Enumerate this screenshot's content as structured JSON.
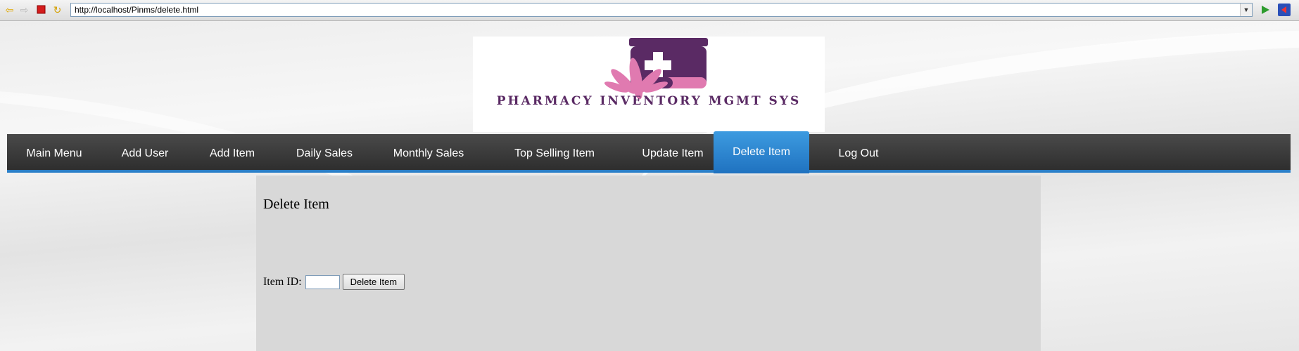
{
  "browser": {
    "url": "http://localhost/Pinms/delete.html",
    "back_icon": "back-arrow-icon",
    "forward_icon": "forward-arrow-icon",
    "stop_icon": "stop-icon",
    "refresh_icon": "refresh-icon",
    "go_icon": "go-arrow-icon",
    "exit_icon": "exit-icon"
  },
  "header": {
    "logo_title": "PHARMACY INVENTORY MGMT SYS",
    "colors": {
      "logo_purple": "#5a2a64",
      "logo_pink": "#e07ab0"
    }
  },
  "nav": {
    "items": [
      {
        "label": "Main Menu"
      },
      {
        "label": "Add User"
      },
      {
        "label": "Add Item"
      },
      {
        "label": "Daily Sales"
      },
      {
        "label": "Monthly Sales"
      },
      {
        "label": "Top Selling Item"
      },
      {
        "label": "Update Item"
      },
      {
        "label": "Delete Item",
        "active": true
      },
      {
        "label": "Log Out"
      }
    ],
    "colors": {
      "bar": "#3a3a3a",
      "active": "#2a84d4"
    }
  },
  "main": {
    "title": "Delete Item",
    "item_id_label": "Item ID:",
    "item_id_value": "",
    "submit_label": "Delete Item"
  }
}
